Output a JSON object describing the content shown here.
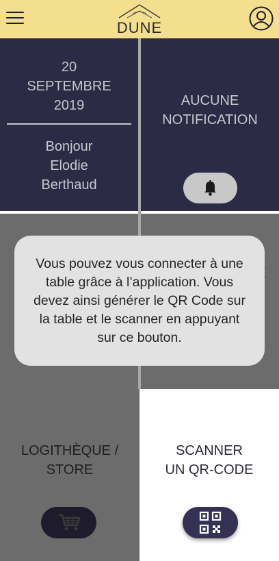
{
  "header": {
    "logo_text": "DUNE",
    "menu_icon": "hamburger-menu-icon",
    "profile_icon": "user-profile-icon",
    "background_color": "#f4df8f"
  },
  "tiles": {
    "date": {
      "text": "20\nSEPTEMBRE\n2019"
    },
    "greeting": {
      "text": "Bonjour\nElodie\nBerthaud"
    },
    "notifications": {
      "text": "AUCUNE\nNOTIFICATION",
      "button_icon": "bell-icon"
    },
    "middle_right_partial": {
      "text": "E"
    },
    "store": {
      "text": "LOGITHÈQUE /\nSTORE",
      "button_icon": "shopping-cart-icon"
    },
    "scanner": {
      "text": "SCANNER\nUN QR-CODE",
      "button_icon": "qr-code-icon"
    }
  },
  "tooltip": {
    "text": "Vous pouvez vous connecter à une\ntable grâce à l’application. Vous\ndevez ainsi générer le QR Code sur\nla table et le scanner en appuyant\nsur ce bouton."
  },
  "colors": {
    "dark_tile": "#2c2b45",
    "dimmed_tile": "#6c6c6c",
    "highlight_tile": "#ffffff",
    "tooltip_bg": "#e2e2e2",
    "accent_button": "#343155"
  }
}
